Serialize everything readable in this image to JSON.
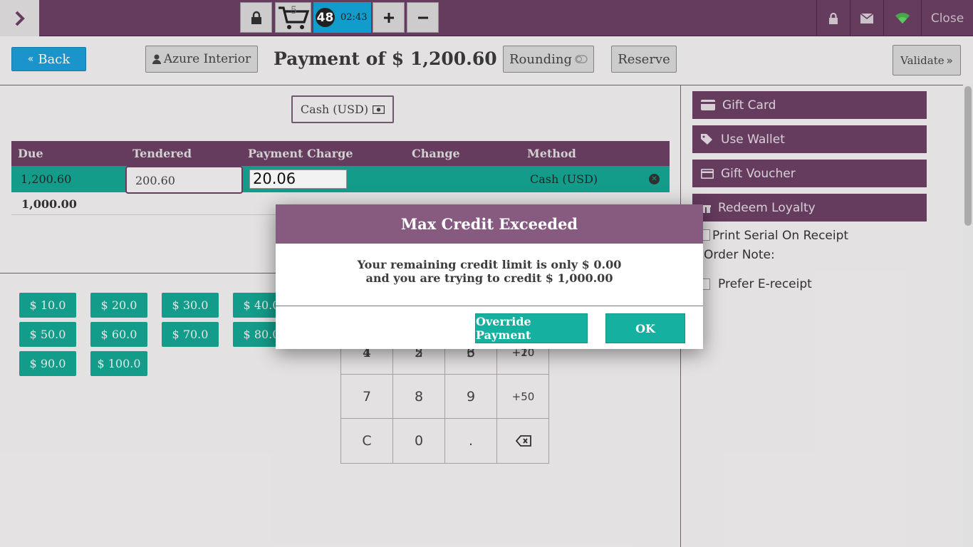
{
  "topbar": {
    "cart_count": "5",
    "order_number": "48",
    "order_time": "02:43",
    "close_label": "Close"
  },
  "header": {
    "back_label": "Back",
    "customer_label": "Azure Interior",
    "payment_title": "Payment of $ 1,200.60",
    "rounding_label": "Rounding",
    "reserve_label": "Reserve",
    "validate_label": "Validate"
  },
  "payment_method_button": "Cash (USD)",
  "lines": {
    "columns": [
      "Due",
      "Tendered",
      "Payment Charge",
      "Change",
      "Method"
    ],
    "row": {
      "due": "1,200.60",
      "tendered": "200.60",
      "payment_charge": "20.06",
      "change": "",
      "method": "Cash (USD)"
    },
    "remaining": "1,000.00"
  },
  "quick_amounts": [
    "$ 10.0",
    "$ 20.0",
    "$ 30.0",
    "$ 40.0",
    "$ 50.0",
    "$ 60.0",
    "$ 70.0",
    "$ 80.0",
    "$ 90.0",
    "$ 100.0"
  ],
  "numpad": {
    "keys": [
      "1",
      "2",
      "3",
      "+10",
      "4",
      "5",
      "6",
      "+20",
      "7",
      "8",
      "9",
      "+50",
      "C",
      "0",
      ".",
      "backspace"
    ]
  },
  "right_panel": {
    "buttons": [
      "Gift Card",
      "Use Wallet",
      "Gift Voucher",
      "Redeem Loyalty"
    ],
    "print_serial_label": "Print Serial On Receipt",
    "order_note_label": "Order Note:",
    "prefer_ereceipt_label": "Prefer E-receipt"
  },
  "modal": {
    "title": "Max Credit Exceeded",
    "line1": "Your remaining credit limit is only $ 0.00",
    "line2": "and you are trying to credit $ 1,000.00",
    "override_label": "Override Payment",
    "ok_label": "OK"
  },
  "colors": {
    "brand_purple": "#6b3f64",
    "teal": "#15a591",
    "blue": "#1d9bd6",
    "modal_header": "#875a80"
  }
}
